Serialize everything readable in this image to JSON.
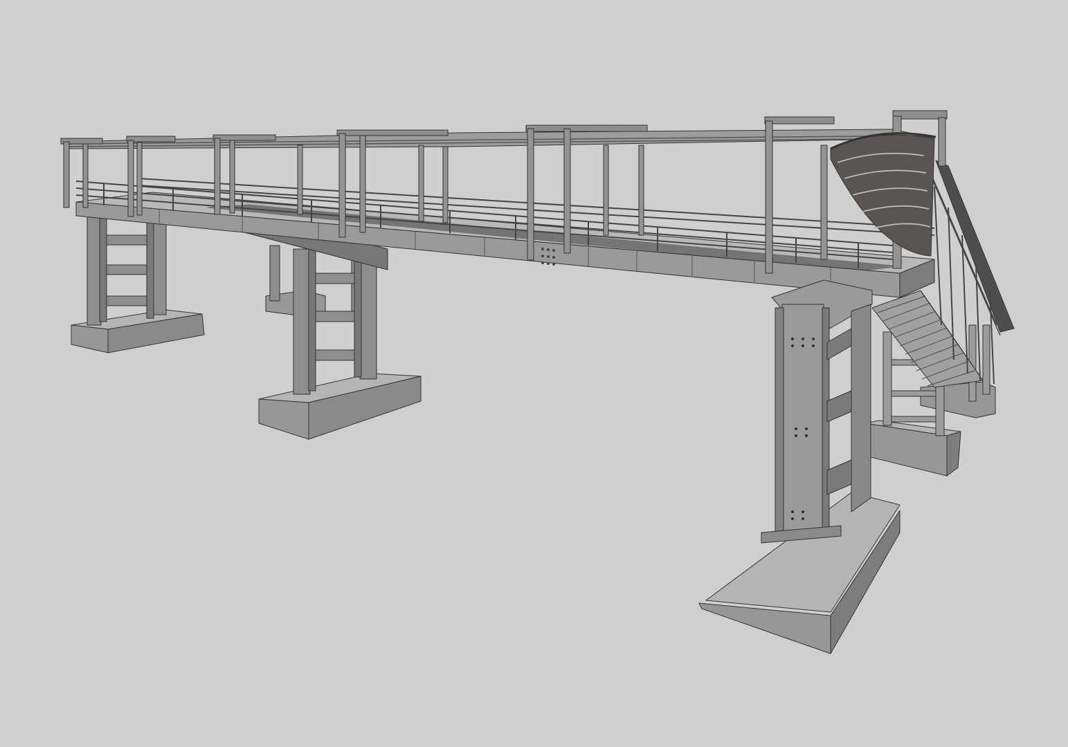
{
  "scene": {
    "subject": "pedestrian-footbridge",
    "colors": {
      "background": "#cfcfcf",
      "steel": "#8e8e8e",
      "steel_light": "#a8a8a8",
      "steel_dark": "#6a6a6a",
      "concrete_top": "#b5b5b5",
      "concrete_front": "#979797",
      "concrete_side": "#7d7d7d",
      "roof": "#5a5553",
      "outline": "#333333"
    }
  }
}
